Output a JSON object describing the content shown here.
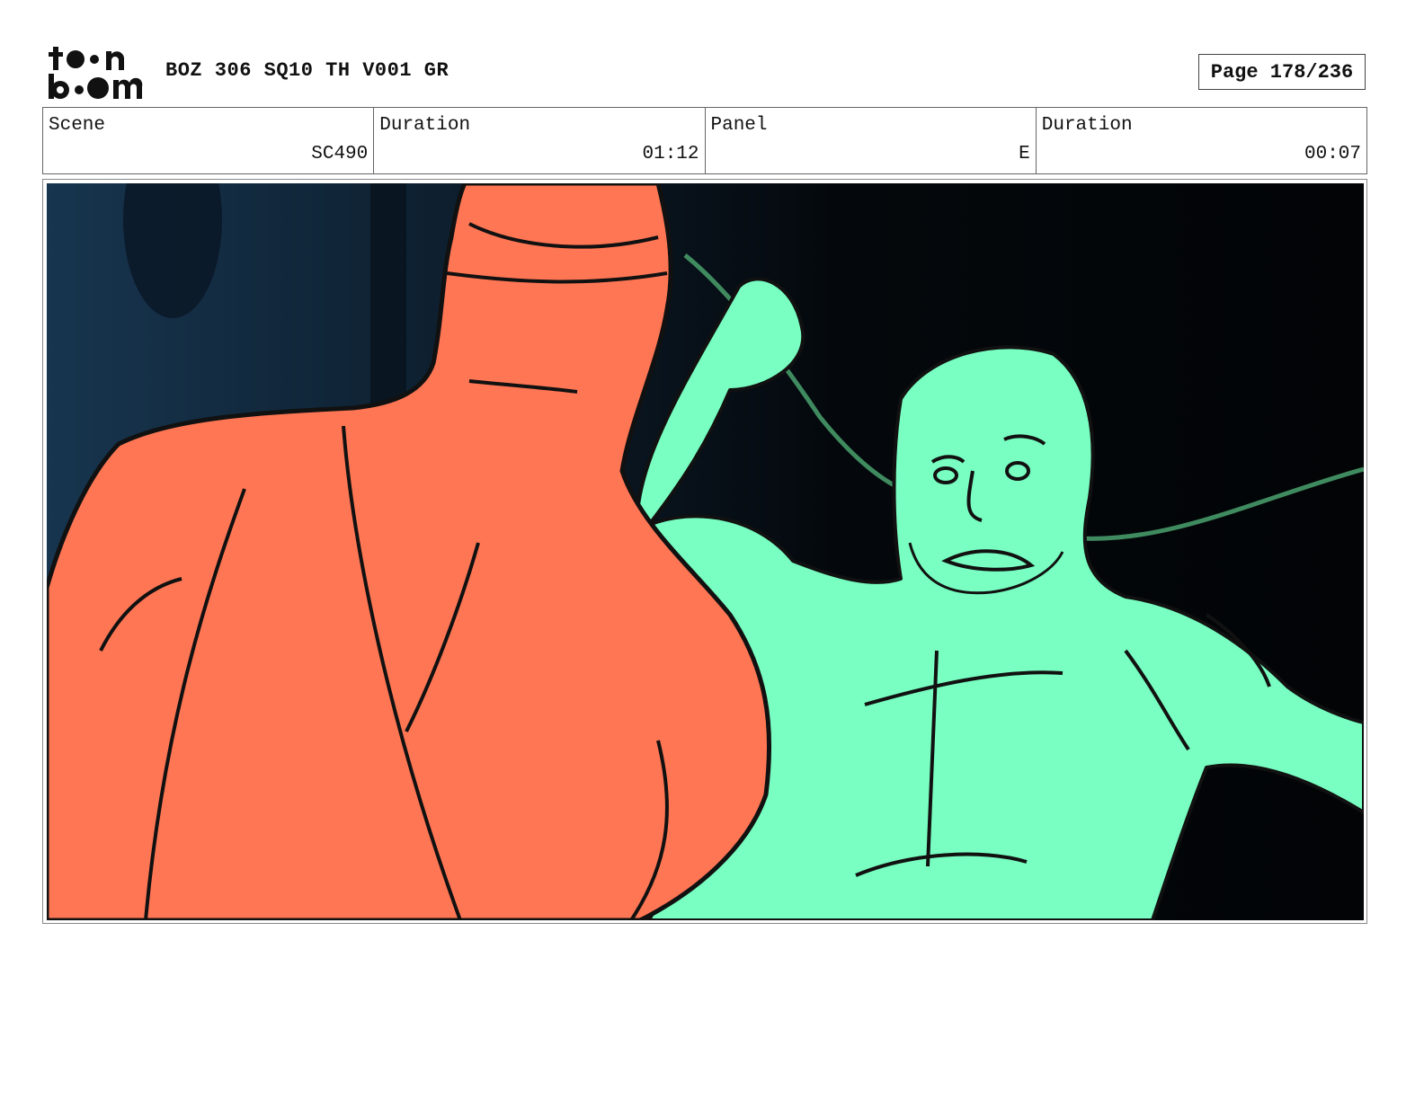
{
  "header": {
    "logo_text_top": "toon",
    "logo_text_bottom": "boom",
    "title": "BOZ 306 SQ10 TH V001 GR",
    "page_label": "Page 178/236"
  },
  "info": {
    "scene_label": "Scene",
    "scene_value": "SC490",
    "scene_duration_label": "Duration",
    "scene_duration_value": "01:12",
    "panel_label": "Panel",
    "panel_value": "E",
    "panel_duration_label": "Duration",
    "panel_duration_value": "00:07"
  },
  "colors": {
    "left_character": "#ff7654",
    "right_character": "#78ffc1",
    "rope": "#3f8a5f",
    "background": "#04080c"
  }
}
